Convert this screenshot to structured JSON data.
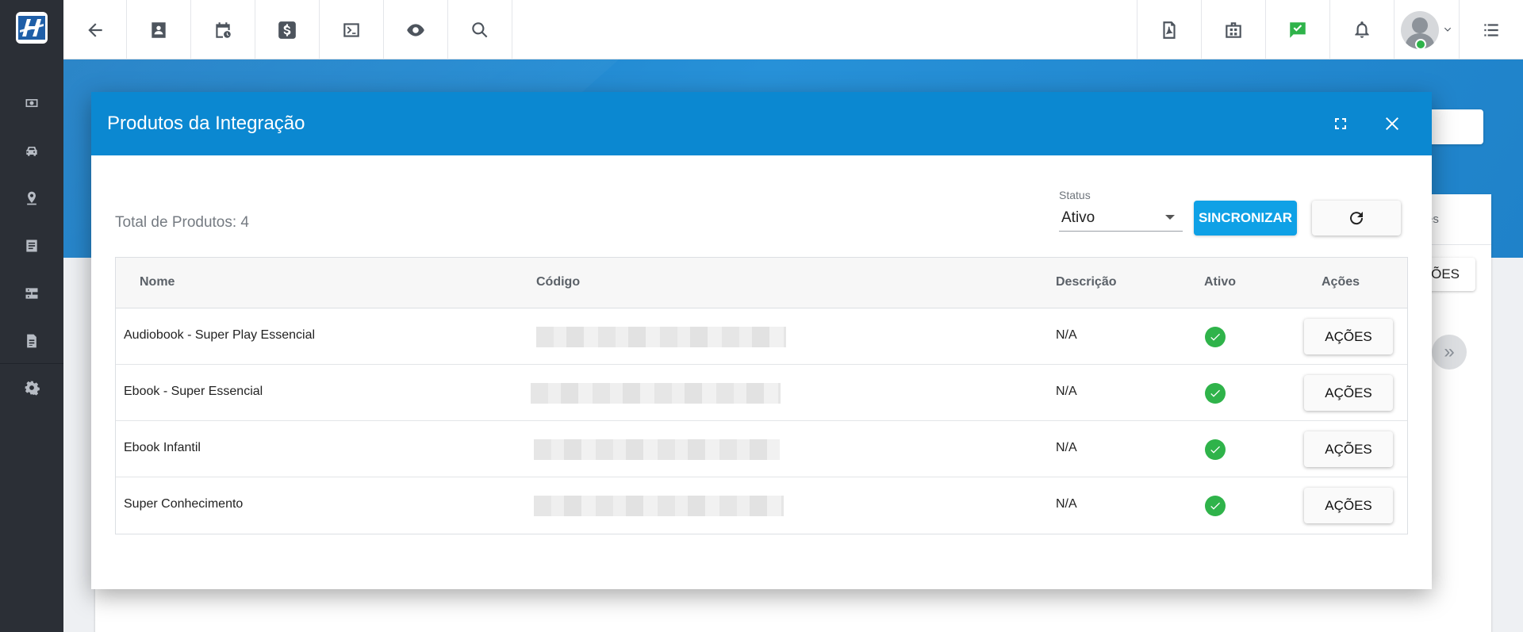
{
  "sidebar": {
    "logo_letter": "H",
    "items": [
      {
        "icon": "money-icon"
      },
      {
        "icon": "car-icon"
      },
      {
        "icon": "location-pin-icon"
      },
      {
        "icon": "list-document-icon"
      },
      {
        "icon": "server-icon"
      },
      {
        "icon": "document-icon"
      },
      {
        "icon": "gear-icon"
      }
    ]
  },
  "topbar": {
    "left_icons": [
      "back-arrow-icon",
      "contact-card-icon",
      "calendar-clock-icon",
      "dollar-icon",
      "terminal-icon",
      "eye-icon",
      "search-icon"
    ],
    "right_icons": [
      "pdf-icon",
      "briefcase-icon",
      "chat-check-icon",
      "bell-icon",
      "user-avatar",
      "menu-list-icon"
    ],
    "accent_check_color": "#2fb34a"
  },
  "background": {
    "tab_text": "es",
    "actions_label": "ÇÕES",
    "chevron": "»"
  },
  "modal": {
    "title": "Produtos da Integração",
    "total_label": "Total de Produtos: 4",
    "status_label": "Status",
    "status_value": "Ativo",
    "sync_label": "SINCRONIZAR",
    "header_color": "#0b88d1",
    "sync_color": "#0fa1e6"
  },
  "table": {
    "columns": {
      "name": "Nome",
      "code": "Código",
      "description": "Descrição",
      "active": "Ativo",
      "actions": "Ações"
    },
    "rows": [
      {
        "name": "Audiobook - Super Play Essencial",
        "description": "N/A",
        "actions": "AÇÕES"
      },
      {
        "name": "Ebook - Super Essencial",
        "description": "N/A",
        "actions": "AÇÕES"
      },
      {
        "name": "Ebook Infantil",
        "description": "N/A",
        "actions": "AÇÕES"
      },
      {
        "name": "Super Conhecimento",
        "description": "N/A",
        "actions": "AÇÕES"
      }
    ]
  }
}
